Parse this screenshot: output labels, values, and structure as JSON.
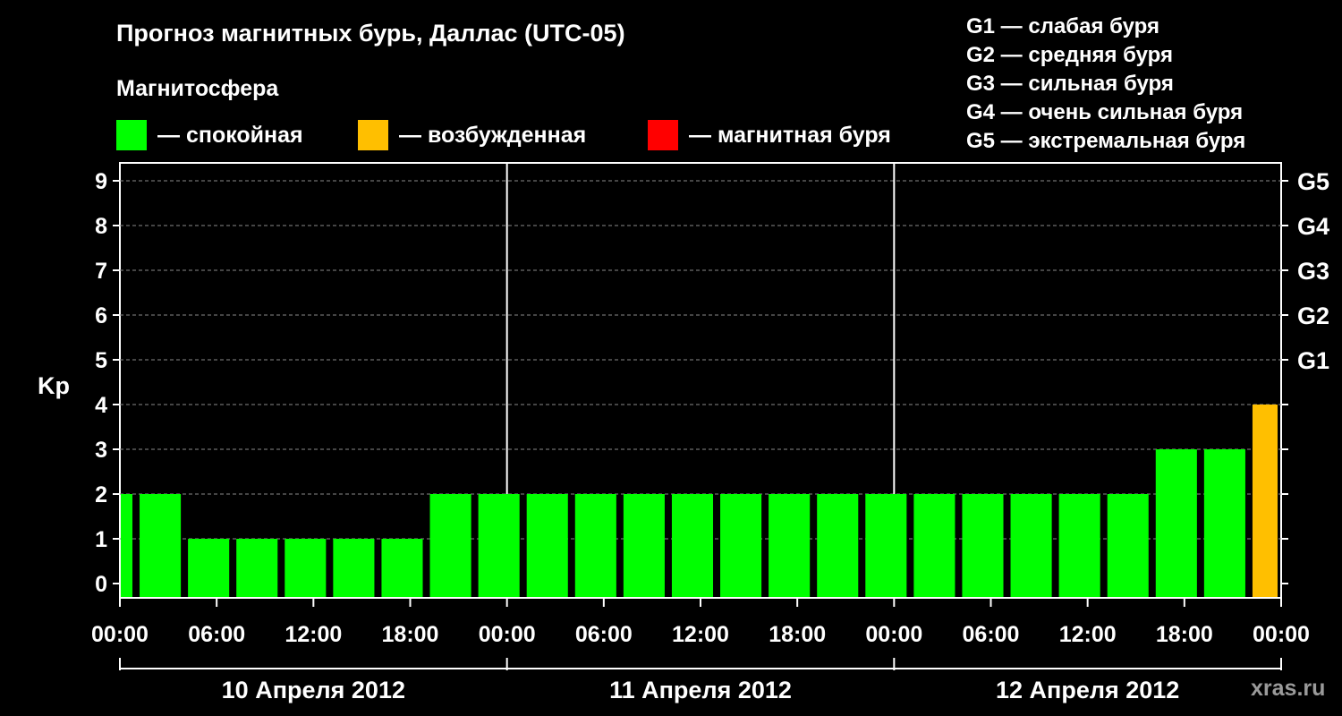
{
  "header": {
    "title": "Прогноз магнитных бурь, Даллас (UTC-05)",
    "subtitle": "Магнитосфера"
  },
  "legend": [
    {
      "label": "— спокойная",
      "color": "#00ff00"
    },
    {
      "label": "— возбужденная",
      "color": "#ffbf00"
    },
    {
      "label": "— магнитная буря",
      "color": "#ff0000"
    }
  ],
  "g_legend": [
    "G1 — слабая буря",
    "G2 — средняя буря",
    "G3 — сильная буря",
    "G4 — очень сильная буря",
    "G5 — экстремальная буря"
  ],
  "watermark": "xras.ru",
  "chart_data": {
    "type": "bar",
    "ylabel": "Kp",
    "ylim": [
      0,
      9
    ],
    "yticks": [
      "0",
      "1",
      "2",
      "3",
      "4",
      "5",
      "6",
      "7",
      "8",
      "9"
    ],
    "right_ticks": [
      {
        "kp": 5,
        "label": "G1"
      },
      {
        "kp": 6,
        "label": "G2"
      },
      {
        "kp": 7,
        "label": "G3"
      },
      {
        "kp": 8,
        "label": "G4"
      },
      {
        "kp": 9,
        "label": "G5"
      }
    ],
    "grid": true,
    "xticks": [
      "00:00",
      "06:00",
      "12:00",
      "18:00",
      "00:00",
      "06:00",
      "12:00",
      "18:00",
      "00:00",
      "06:00",
      "12:00",
      "18:00",
      "00:00"
    ],
    "days": [
      "10 Апреля 2012",
      "11 Апреля 2012",
      "12 Апреля 2012"
    ],
    "bars": [
      {
        "start_hour": 0,
        "end_hour": 1,
        "kp": 2,
        "status": "quiet"
      },
      {
        "start_hour": 1,
        "end_hour": 4,
        "kp": 2,
        "status": "quiet"
      },
      {
        "start_hour": 4,
        "end_hour": 7,
        "kp": 1,
        "status": "quiet"
      },
      {
        "start_hour": 7,
        "end_hour": 10,
        "kp": 1,
        "status": "quiet"
      },
      {
        "start_hour": 10,
        "end_hour": 13,
        "kp": 1,
        "status": "quiet"
      },
      {
        "start_hour": 13,
        "end_hour": 16,
        "kp": 1,
        "status": "quiet"
      },
      {
        "start_hour": 16,
        "end_hour": 19,
        "kp": 1,
        "status": "quiet"
      },
      {
        "start_hour": 19,
        "end_hour": 22,
        "kp": 2,
        "status": "quiet"
      },
      {
        "start_hour": 22,
        "end_hour": 25,
        "kp": 2,
        "status": "quiet"
      },
      {
        "start_hour": 25,
        "end_hour": 28,
        "kp": 2,
        "status": "quiet"
      },
      {
        "start_hour": 28,
        "end_hour": 31,
        "kp": 2,
        "status": "quiet"
      },
      {
        "start_hour": 31,
        "end_hour": 34,
        "kp": 2,
        "status": "quiet"
      },
      {
        "start_hour": 34,
        "end_hour": 37,
        "kp": 2,
        "status": "quiet"
      },
      {
        "start_hour": 37,
        "end_hour": 40,
        "kp": 2,
        "status": "quiet"
      },
      {
        "start_hour": 40,
        "end_hour": 43,
        "kp": 2,
        "status": "quiet"
      },
      {
        "start_hour": 43,
        "end_hour": 46,
        "kp": 2,
        "status": "quiet"
      },
      {
        "start_hour": 46,
        "end_hour": 49,
        "kp": 2,
        "status": "quiet"
      },
      {
        "start_hour": 49,
        "end_hour": 52,
        "kp": 2,
        "status": "quiet"
      },
      {
        "start_hour": 52,
        "end_hour": 55,
        "kp": 2,
        "status": "quiet"
      },
      {
        "start_hour": 55,
        "end_hour": 58,
        "kp": 2,
        "status": "quiet"
      },
      {
        "start_hour": 58,
        "end_hour": 61,
        "kp": 2,
        "status": "quiet"
      },
      {
        "start_hour": 61,
        "end_hour": 64,
        "kp": 2,
        "status": "quiet"
      },
      {
        "start_hour": 64,
        "end_hour": 67,
        "kp": 3,
        "status": "quiet"
      },
      {
        "start_hour": 67,
        "end_hour": 70,
        "kp": 3,
        "status": "quiet"
      },
      {
        "start_hour": 70,
        "end_hour": 72,
        "kp": 4,
        "status": "active"
      }
    ],
    "colors": {
      "quiet": "#00ff00",
      "active": "#ffbf00",
      "storm": "#ff0000"
    }
  }
}
